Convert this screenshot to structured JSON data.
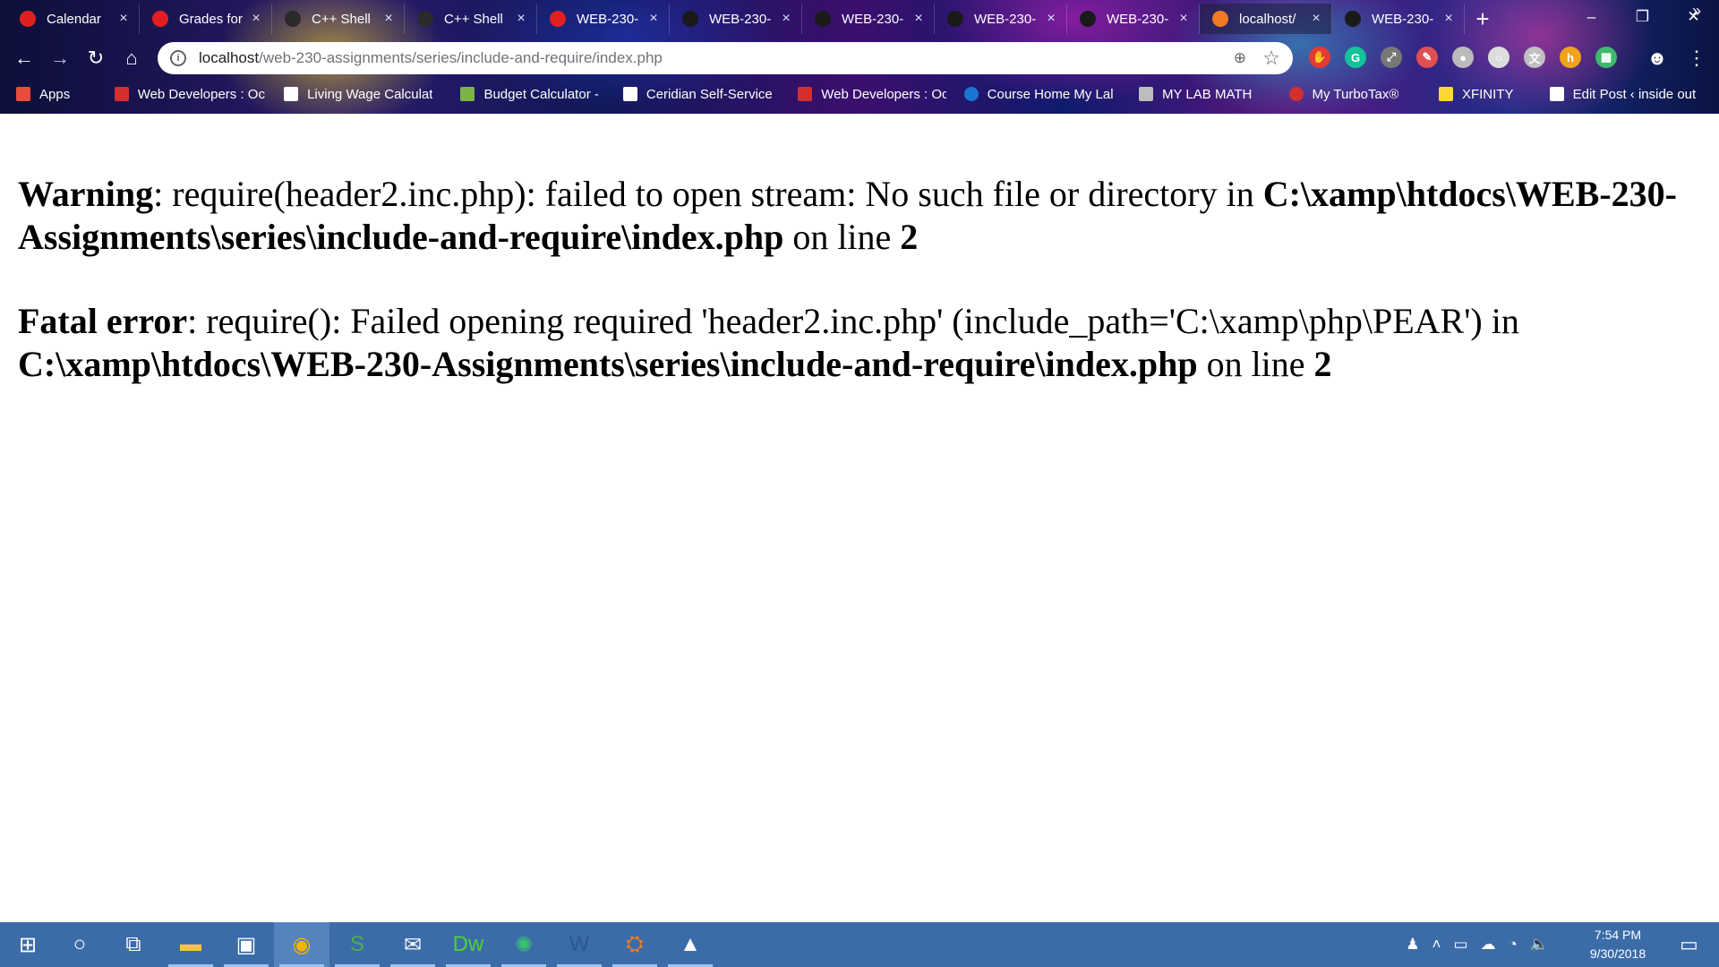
{
  "browser": {
    "tabs": [
      {
        "title": "Calendar",
        "icon": "canvas-red-icon",
        "color": "#e02020"
      },
      {
        "title": "Grades for",
        "icon": "canvas-red-icon",
        "color": "#e02020"
      },
      {
        "title": "C++ Shell",
        "icon": "cpp-shell-icon",
        "color": "#2a2a2a"
      },
      {
        "title": "C++ Shell",
        "icon": "cpp-shell-icon",
        "color": "#2a2a2a"
      },
      {
        "title": "WEB-230-",
        "icon": "canvas-red-icon",
        "color": "#e02020"
      },
      {
        "title": "WEB-230-",
        "icon": "github-icon",
        "color": "#1a1a1a"
      },
      {
        "title": "WEB-230-",
        "icon": "github-icon",
        "color": "#1a1a1a"
      },
      {
        "title": "WEB-230-",
        "icon": "github-icon",
        "color": "#1a1a1a"
      },
      {
        "title": "WEB-230-",
        "icon": "github-icon",
        "color": "#1a1a1a"
      },
      {
        "title": "localhost/",
        "icon": "xampp-icon",
        "color": "#f07a21",
        "active": true
      },
      {
        "title": "WEB-230-",
        "icon": "github-icon",
        "color": "#1a1a1a"
      }
    ],
    "close_glyph": "×",
    "new_tab_glyph": "+",
    "window_controls": {
      "minimize": "–",
      "restore": "❐",
      "close": "✕"
    },
    "url": {
      "host": "localhost",
      "path": "/web-230-assignments/series/include-and-require/index.php"
    },
    "info_glyph": "i",
    "zoom_glyph": "⊕",
    "star_glyph": "☆",
    "extensions": [
      {
        "name": "adblock-icon",
        "glyph": "✋",
        "color": "#e53935"
      },
      {
        "name": "grammarly-icon",
        "glyph": "G",
        "color": "#15c39a"
      },
      {
        "name": "acrobat-icon",
        "glyph": "⤢",
        "color": "#777777"
      },
      {
        "name": "extension-icon",
        "glyph": "✎",
        "color": "#e05050"
      },
      {
        "name": "circle-icon",
        "glyph": "●",
        "color": "#bbbbbb"
      },
      {
        "name": "ring-icon",
        "glyph": "○",
        "color": "#dddddd"
      },
      {
        "name": "translate-icon",
        "glyph": "文",
        "color": "#c0c0c0"
      },
      {
        "name": "honey-icon",
        "glyph": "h",
        "color": "#f2a31b"
      },
      {
        "name": "sheets-icon",
        "glyph": "▦",
        "color": "#3cba6c"
      }
    ],
    "profile_glyph": "☻",
    "menu_glyph": "⋮",
    "bookmarks": [
      {
        "label": "Apps",
        "icon": "apps-grid-icon",
        "color": "#e74c3c"
      },
      {
        "label": "Web Developers : Oc",
        "icon": "red-star-icon",
        "color": "#d32f2f"
      },
      {
        "label": "Living Wage Calculat",
        "icon": "page-icon",
        "color": "#ffffff"
      },
      {
        "label": "Budget Calculator -",
        "icon": "chart-icon",
        "color": "#7cb342"
      },
      {
        "label": "Ceridian Self-Service",
        "icon": "page-icon",
        "color": "#ffffff"
      },
      {
        "label": "Web Developers : Oc",
        "icon": "red-star-icon",
        "color": "#d32f2f"
      },
      {
        "label": "Course Home My Lal",
        "icon": "pearson-icon",
        "color": "#1976d2"
      },
      {
        "label": "MY LAB MATH",
        "icon": "doc-icon",
        "color": "#bdbdbd"
      },
      {
        "label": "My TurboTax®",
        "icon": "check-icon",
        "color": "#d32f2f"
      },
      {
        "label": "XFINITY",
        "icon": "folder-icon",
        "color": "#fdd835"
      },
      {
        "label": "Edit Post ‹ inside out",
        "icon": "page-icon",
        "color": "#ffffff"
      }
    ],
    "bookmarks_more": "»"
  },
  "page": {
    "warning": {
      "label": "Warning",
      "text": ": require(header2.inc.php): failed to open stream: No such file or directory in ",
      "file": "C:\\xamp\\htdocs\\WEB-230-Assignments\\series\\include-and-require\\index.php",
      "on_line": " on line ",
      "line": "2"
    },
    "fatal": {
      "label": "Fatal error",
      "text": ": require(): Failed opening required 'header2.inc.php' (include_path='C:\\xamp\\php\\PEAR') in ",
      "file": "C:\\xamp\\htdocs\\WEB-230-Assignments\\series\\include-and-require\\index.php",
      "on_line": " on line ",
      "line": "2"
    }
  },
  "taskbar": {
    "apps": [
      {
        "name": "start-button",
        "glyph": "⊞"
      },
      {
        "name": "cortana-search-icon",
        "glyph": "○"
      },
      {
        "name": "task-view-icon",
        "glyph": "⧉"
      },
      {
        "name": "file-explorer-icon",
        "glyph": "▬",
        "color": "#f6c343"
      },
      {
        "name": "store-icon",
        "glyph": "▣",
        "color": "#ffffff"
      },
      {
        "name": "chrome-icon",
        "glyph": "◉",
        "color": "#f4b400",
        "active": true
      },
      {
        "name": "slack-s-icon",
        "glyph": "S",
        "color": "#4caf50"
      },
      {
        "name": "mail-icon",
        "glyph": "✉",
        "color": "#ffffff"
      },
      {
        "name": "dreamweaver-icon",
        "glyph": "Dw",
        "color": "#4cd137"
      },
      {
        "name": "globe-app-icon",
        "glyph": "✺",
        "color": "#38c172"
      },
      {
        "name": "word-icon",
        "glyph": "W",
        "color": "#2b579a"
      },
      {
        "name": "xampp-taskbar-icon",
        "glyph": "⛭",
        "color": "#f07a21"
      },
      {
        "name": "photos-icon",
        "glyph": "▲",
        "color": "#ffffff"
      }
    ],
    "tray": [
      "♟",
      "˄",
      "▭",
      "☁",
      "◔",
      "🔈"
    ],
    "clock_time": "7:54 PM",
    "clock_date": "9/30/2018",
    "notifications_glyph": "▭"
  }
}
